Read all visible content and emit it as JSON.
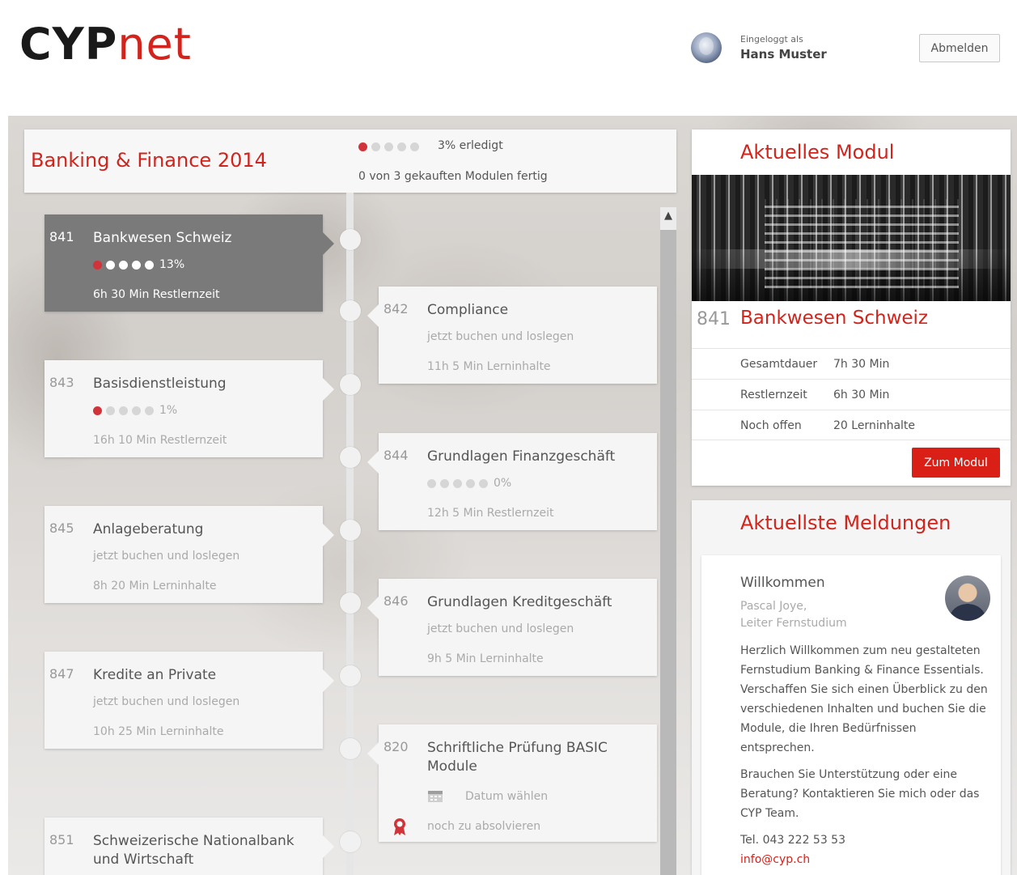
{
  "header": {
    "logo_part1": "CYP",
    "logo_part2": "net",
    "logged_label": "Eingeloggt als",
    "user_name": "Hans Muster",
    "logout_label": "Abmelden"
  },
  "course": {
    "title": "Banking & Finance 2014",
    "progress_label": "3% erledigt",
    "progress_percent": 3,
    "modules_done": "0 von 3 gekauften Modulen fertig"
  },
  "modules": [
    {
      "num": "841",
      "name": "Bankwesen Schweiz",
      "pct": "13%",
      "time": "6h 30 Min Restlernzeit"
    },
    {
      "num": "842",
      "name": "Compliance",
      "line2": "jetzt buchen und loslegen",
      "time": "11h 5 Min Lerninhalte"
    },
    {
      "num": "843",
      "name": "Basisdienstleistung",
      "pct": "1%",
      "time": "16h 10 Min Restlernzeit"
    },
    {
      "num": "844",
      "name": "Grundlagen Finanzgeschäft",
      "pct": "0%",
      "time": "12h 5 Min Restlernzeit"
    },
    {
      "num": "845",
      "name": "Anlageberatung",
      "line2": "jetzt buchen und loslegen",
      "time": "8h 20 Min Lerninhalte"
    },
    {
      "num": "846",
      "name": "Grundlagen Kreditgeschäft",
      "line2": "jetzt buchen und loslegen",
      "time": "9h 5 Min Lerninhalte"
    },
    {
      "num": "847",
      "name": "Kredite an Private",
      "line2": "jetzt buchen und loslegen",
      "time": "10h 25 Min Lerninhalte"
    },
    {
      "num": "820",
      "name": "Schriftliche Prüfung BASIC Module",
      "line2": "Datum wählen",
      "time": "noch zu absolvieren"
    },
    {
      "num": "851",
      "name": "Schweizerische Nationalbank und Wirtschaft"
    }
  ],
  "current_module": {
    "title": "Aktuelles Modul",
    "num": "841",
    "name": "Bankwesen Schweiz",
    "rows": [
      {
        "k": "Gesamtdauer",
        "v": "7h 30 Min"
      },
      {
        "k": "Restlernzeit",
        "v": "6h 30 Min"
      },
      {
        "k": "Noch offen",
        "v": "20 Lerninhalte"
      }
    ],
    "button": "Zum Modul"
  },
  "news": {
    "title": "Aktuellste Meldungen",
    "item_title": "Willkommen",
    "author_name": "Pascal Joye,",
    "author_role": "Leiter Fernstudium",
    "p1": "Herzlich Willkommen zum neu gestalteten Fernstudium Banking & Finance Essentials. Verschaffen Sie sich einen Überblick zu den verschiedenen Inhalten und buchen Sie die Module, die Ihren Bedürfnissen entsprechen.",
    "p2": "Brauchen Sie Unterstützung oder eine Beratung? Kontaktieren Sie mich oder das CYP Team.",
    "phone": "Tel. 043 222 53 53",
    "email": "info@cyp.ch"
  },
  "colors": {
    "accent": "#d0241c",
    "active_card": "#7a7a7a",
    "dot_red": "#d0343a"
  },
  "icons": [
    "user-avatar",
    "chevron-up-icon",
    "calendar-icon",
    "award-icon"
  ]
}
